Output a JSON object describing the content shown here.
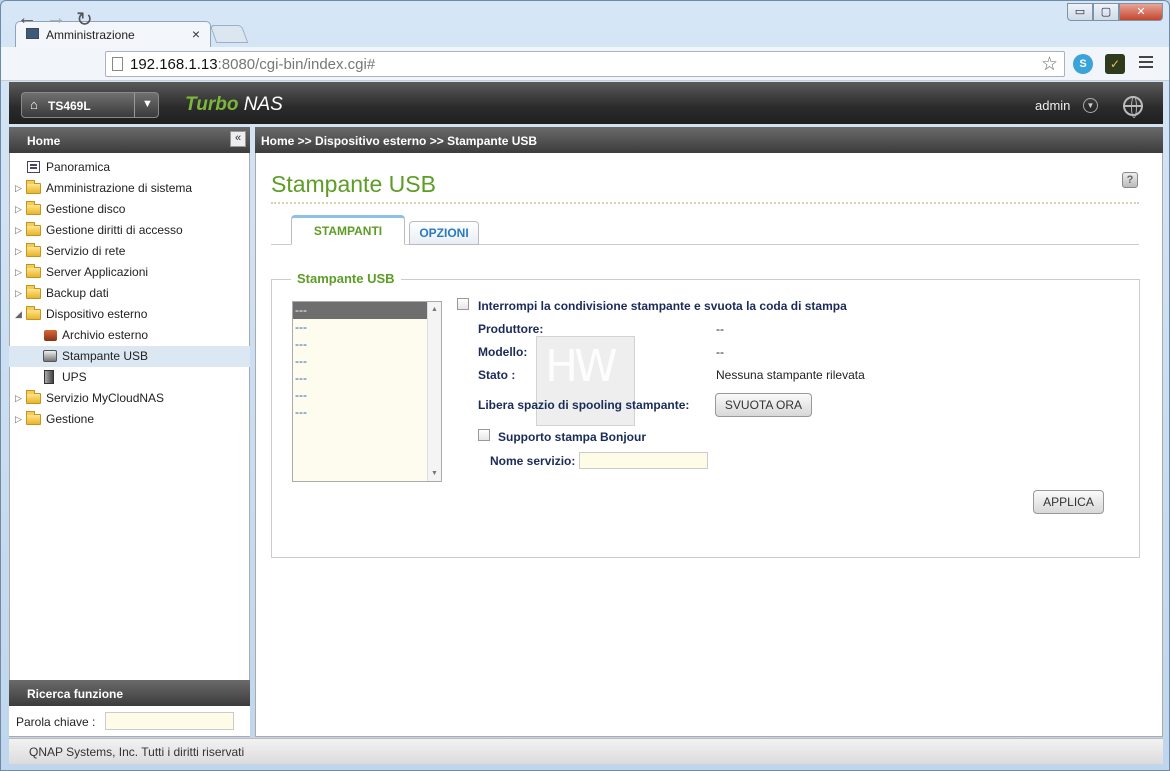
{
  "browser": {
    "tab_title": "Amministrazione",
    "tab_close": "×",
    "url_host": "192.168.1.13",
    "url_rest": ":8080/cgi-bin/index.cgi#",
    "window_min": "▭",
    "window_max": "▢",
    "window_close": "✕",
    "back": "←",
    "forward": "→",
    "reload": "↻",
    "star": "☆"
  },
  "nas_header": {
    "model": "TS469L",
    "brand_turbo": "Turbo",
    "brand_nas": " NAS",
    "user": "admin"
  },
  "sidebar": {
    "title": "Home",
    "collapse": "«",
    "items": [
      {
        "label": "Panoramica"
      },
      {
        "label": "Amministrazione di sistema"
      },
      {
        "label": "Gestione disco"
      },
      {
        "label": "Gestione diritti di accesso"
      },
      {
        "label": "Servizio di rete"
      },
      {
        "label": "Server Applicazioni"
      },
      {
        "label": "Backup dati"
      },
      {
        "label": "Dispositivo esterno"
      },
      {
        "label": "Archivio esterno"
      },
      {
        "label": "Stampante USB"
      },
      {
        "label": "UPS"
      },
      {
        "label": "Servizio MyCloudNAS"
      },
      {
        "label": "Gestione"
      }
    ],
    "search_title": "Ricerca funzione",
    "keyword_label": "Parola chiave :"
  },
  "main": {
    "breadcrumb": "Home >> Dispositivo esterno >> Stampante USB",
    "title": "Stampante USB",
    "help": "?",
    "tabs": [
      {
        "label": "STAMPANTI"
      },
      {
        "label": "OPZIONI"
      }
    ],
    "section_title": "Stampante USB",
    "printer_list": [
      "---",
      "---",
      "---",
      "---",
      "---",
      "---",
      "---"
    ],
    "stop_sharing_label": "Interrompi la condivisione stampante e svuota la coda di stampa",
    "manufacturer_label": "Produttore:",
    "manufacturer_value": "--",
    "model_label": "Modello:",
    "model_value": "--",
    "status_label": "Stato :",
    "status_value": "Nessuna stampante rilevata",
    "spool_label": "Libera spazio di spooling stampante:",
    "spool_button": "SVUOTA ORA",
    "bonjour_label": "Supporto stampa Bonjour",
    "service_name_label": "Nome servizio:",
    "apply_button": "APPLICA"
  },
  "footer": {
    "copyright": "QNAP Systems, Inc. Tutti i diritti riservati"
  }
}
